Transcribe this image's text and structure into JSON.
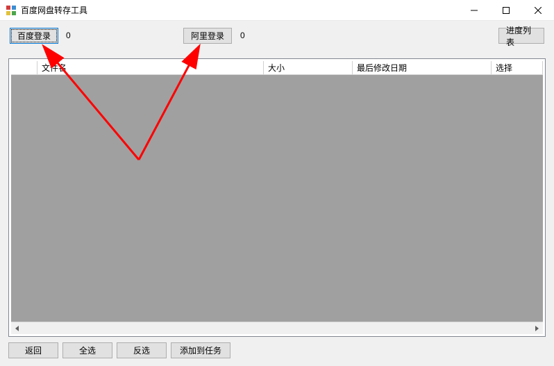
{
  "window": {
    "title": "百度网盘转存工具"
  },
  "toolbar": {
    "baidu_login_label": "百度登录",
    "baidu_count": "0",
    "ali_login_label": "阿里登录",
    "ali_count": "0",
    "progress_list_label": "进度列表"
  },
  "listview": {
    "columns": {
      "filename": "文件名",
      "size": "大小",
      "last_modified": "最后修改日期",
      "select": "选择"
    },
    "rows": []
  },
  "bottom": {
    "back_label": "返回",
    "select_all_label": "全选",
    "invert_label": "反选",
    "add_task_label": "添加到任务"
  },
  "annotation": {
    "color": "#ff0000"
  }
}
